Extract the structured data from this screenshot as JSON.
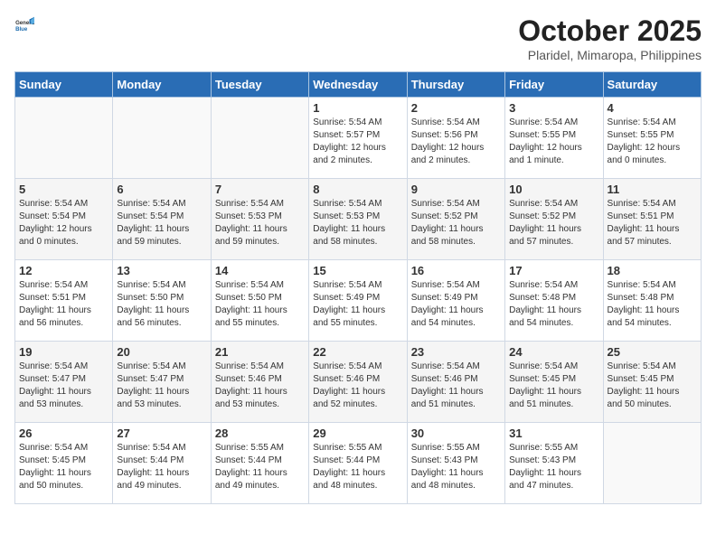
{
  "logo": {
    "general": "General",
    "blue": "Blue"
  },
  "title": "October 2025",
  "subtitle": "Plaridel, Mimaropa, Philippines",
  "headers": [
    "Sunday",
    "Monday",
    "Tuesday",
    "Wednesday",
    "Thursday",
    "Friday",
    "Saturday"
  ],
  "weeks": [
    [
      {
        "day": "",
        "info": ""
      },
      {
        "day": "",
        "info": ""
      },
      {
        "day": "",
        "info": ""
      },
      {
        "day": "1",
        "info": "Sunrise: 5:54 AM\nSunset: 5:57 PM\nDaylight: 12 hours\nand 2 minutes."
      },
      {
        "day": "2",
        "info": "Sunrise: 5:54 AM\nSunset: 5:56 PM\nDaylight: 12 hours\nand 2 minutes."
      },
      {
        "day": "3",
        "info": "Sunrise: 5:54 AM\nSunset: 5:55 PM\nDaylight: 12 hours\nand 1 minute."
      },
      {
        "day": "4",
        "info": "Sunrise: 5:54 AM\nSunset: 5:55 PM\nDaylight: 12 hours\nand 0 minutes."
      }
    ],
    [
      {
        "day": "5",
        "info": "Sunrise: 5:54 AM\nSunset: 5:54 PM\nDaylight: 12 hours\nand 0 minutes."
      },
      {
        "day": "6",
        "info": "Sunrise: 5:54 AM\nSunset: 5:54 PM\nDaylight: 11 hours\nand 59 minutes."
      },
      {
        "day": "7",
        "info": "Sunrise: 5:54 AM\nSunset: 5:53 PM\nDaylight: 11 hours\nand 59 minutes."
      },
      {
        "day": "8",
        "info": "Sunrise: 5:54 AM\nSunset: 5:53 PM\nDaylight: 11 hours\nand 58 minutes."
      },
      {
        "day": "9",
        "info": "Sunrise: 5:54 AM\nSunset: 5:52 PM\nDaylight: 11 hours\nand 58 minutes."
      },
      {
        "day": "10",
        "info": "Sunrise: 5:54 AM\nSunset: 5:52 PM\nDaylight: 11 hours\nand 57 minutes."
      },
      {
        "day": "11",
        "info": "Sunrise: 5:54 AM\nSunset: 5:51 PM\nDaylight: 11 hours\nand 57 minutes."
      }
    ],
    [
      {
        "day": "12",
        "info": "Sunrise: 5:54 AM\nSunset: 5:51 PM\nDaylight: 11 hours\nand 56 minutes."
      },
      {
        "day": "13",
        "info": "Sunrise: 5:54 AM\nSunset: 5:50 PM\nDaylight: 11 hours\nand 56 minutes."
      },
      {
        "day": "14",
        "info": "Sunrise: 5:54 AM\nSunset: 5:50 PM\nDaylight: 11 hours\nand 55 minutes."
      },
      {
        "day": "15",
        "info": "Sunrise: 5:54 AM\nSunset: 5:49 PM\nDaylight: 11 hours\nand 55 minutes."
      },
      {
        "day": "16",
        "info": "Sunrise: 5:54 AM\nSunset: 5:49 PM\nDaylight: 11 hours\nand 54 minutes."
      },
      {
        "day": "17",
        "info": "Sunrise: 5:54 AM\nSunset: 5:48 PM\nDaylight: 11 hours\nand 54 minutes."
      },
      {
        "day": "18",
        "info": "Sunrise: 5:54 AM\nSunset: 5:48 PM\nDaylight: 11 hours\nand 54 minutes."
      }
    ],
    [
      {
        "day": "19",
        "info": "Sunrise: 5:54 AM\nSunset: 5:47 PM\nDaylight: 11 hours\nand 53 minutes."
      },
      {
        "day": "20",
        "info": "Sunrise: 5:54 AM\nSunset: 5:47 PM\nDaylight: 11 hours\nand 53 minutes."
      },
      {
        "day": "21",
        "info": "Sunrise: 5:54 AM\nSunset: 5:46 PM\nDaylight: 11 hours\nand 53 minutes."
      },
      {
        "day": "22",
        "info": "Sunrise: 5:54 AM\nSunset: 5:46 PM\nDaylight: 11 hours\nand 52 minutes."
      },
      {
        "day": "23",
        "info": "Sunrise: 5:54 AM\nSunset: 5:46 PM\nDaylight: 11 hours\nand 51 minutes."
      },
      {
        "day": "24",
        "info": "Sunrise: 5:54 AM\nSunset: 5:45 PM\nDaylight: 11 hours\nand 51 minutes."
      },
      {
        "day": "25",
        "info": "Sunrise: 5:54 AM\nSunset: 5:45 PM\nDaylight: 11 hours\nand 50 minutes."
      }
    ],
    [
      {
        "day": "26",
        "info": "Sunrise: 5:54 AM\nSunset: 5:45 PM\nDaylight: 11 hours\nand 50 minutes."
      },
      {
        "day": "27",
        "info": "Sunrise: 5:54 AM\nSunset: 5:44 PM\nDaylight: 11 hours\nand 49 minutes."
      },
      {
        "day": "28",
        "info": "Sunrise: 5:55 AM\nSunset: 5:44 PM\nDaylight: 11 hours\nand 49 minutes."
      },
      {
        "day": "29",
        "info": "Sunrise: 5:55 AM\nSunset: 5:44 PM\nDaylight: 11 hours\nand 48 minutes."
      },
      {
        "day": "30",
        "info": "Sunrise: 5:55 AM\nSunset: 5:43 PM\nDaylight: 11 hours\nand 48 minutes."
      },
      {
        "day": "31",
        "info": "Sunrise: 5:55 AM\nSunset: 5:43 PM\nDaylight: 11 hours\nand 47 minutes."
      },
      {
        "day": "",
        "info": ""
      }
    ]
  ]
}
